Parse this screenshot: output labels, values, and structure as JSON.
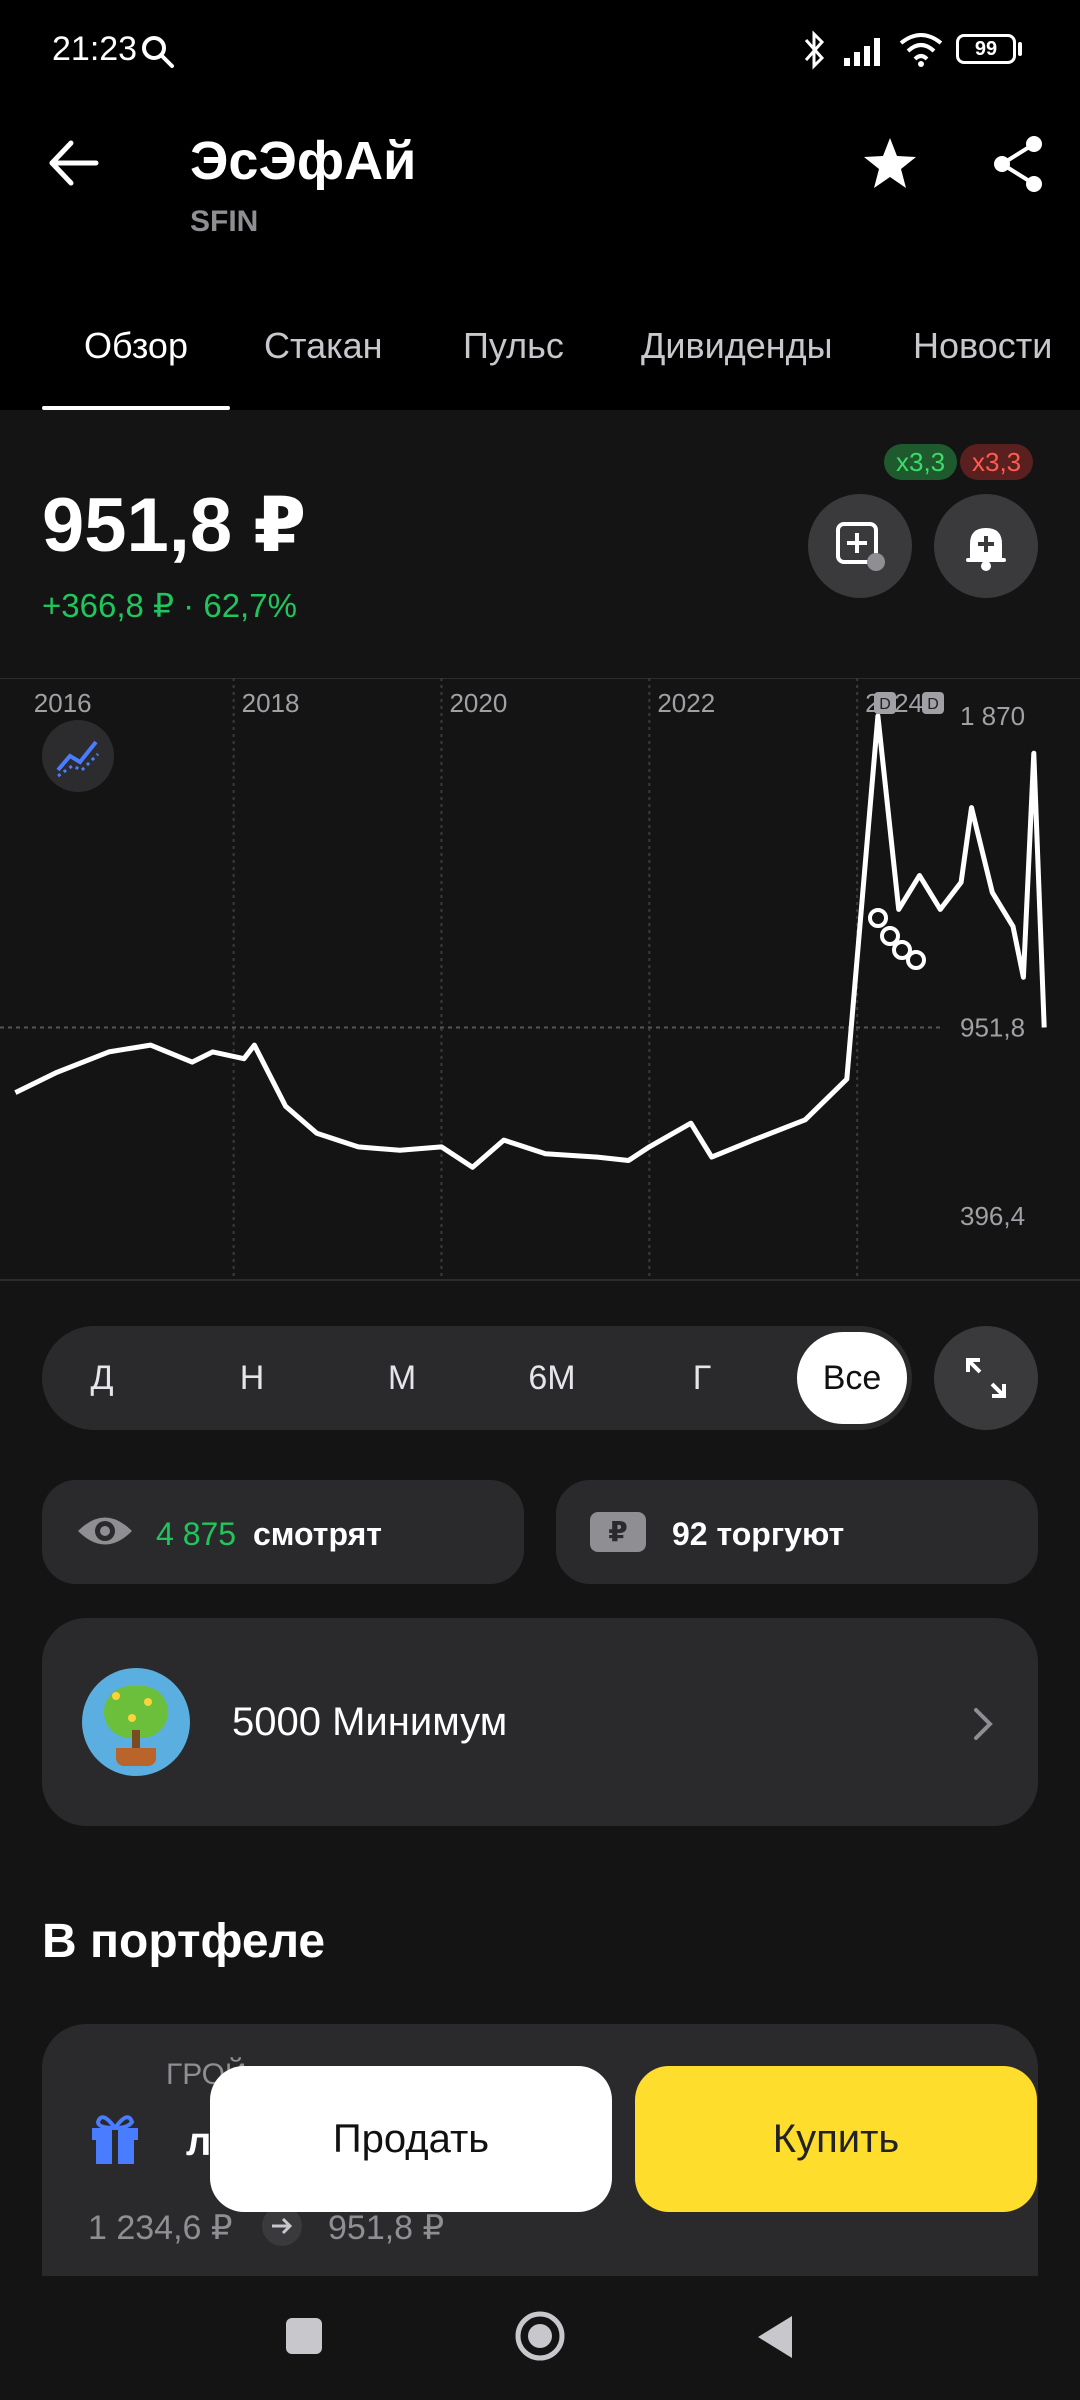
{
  "status_bar": {
    "time": "21:23",
    "battery": "99"
  },
  "header": {
    "title": "ЭсЭфАй",
    "ticker": "SFIN"
  },
  "tabs": [
    {
      "label": "Обзор",
      "active": true
    },
    {
      "label": "Стакан"
    },
    {
      "label": "Пульс"
    },
    {
      "label": "Дивиденды"
    },
    {
      "label": "Новости"
    }
  ],
  "quote": {
    "price": "951,8 ₽",
    "change": "+366,8 ₽ · 62,7%",
    "badge_green": "x3,3",
    "badge_red": "x3,3"
  },
  "chart_data": {
    "type": "line",
    "x_tick_labels": [
      "2016",
      "2018",
      "2020",
      "2022",
      "2024"
    ],
    "y_tick_labels": [
      "1 870",
      "951,8",
      "396,4"
    ],
    "current_value": 951.8,
    "ylim_labels": [
      396.4,
      1870
    ],
    "dividend_markers": [
      "D",
      "D"
    ],
    "series": [
      {
        "values": [
          {
            "x": 2015.9,
            "y": 760
          },
          {
            "x": 2016.3,
            "y": 820
          },
          {
            "x": 2016.8,
            "y": 880
          },
          {
            "x": 2017.2,
            "y": 900
          },
          {
            "x": 2017.6,
            "y": 850
          },
          {
            "x": 2017.8,
            "y": 880
          },
          {
            "x": 2018.1,
            "y": 860
          },
          {
            "x": 2018.2,
            "y": 900
          },
          {
            "x": 2018.5,
            "y": 720
          },
          {
            "x": 2018.8,
            "y": 640
          },
          {
            "x": 2019.2,
            "y": 600
          },
          {
            "x": 2019.6,
            "y": 590
          },
          {
            "x": 2020.0,
            "y": 600
          },
          {
            "x": 2020.3,
            "y": 540
          },
          {
            "x": 2020.6,
            "y": 620
          },
          {
            "x": 2021.0,
            "y": 580
          },
          {
            "x": 2021.5,
            "y": 570
          },
          {
            "x": 2021.8,
            "y": 560
          },
          {
            "x": 2022.0,
            "y": 600
          },
          {
            "x": 2022.4,
            "y": 670
          },
          {
            "x": 2022.6,
            "y": 570
          },
          {
            "x": 2023.0,
            "y": 620
          },
          {
            "x": 2023.5,
            "y": 680
          },
          {
            "x": 2023.9,
            "y": 800
          },
          {
            "x": 2024.2,
            "y": 1870
          },
          {
            "x": 2024.4,
            "y": 1300
          },
          {
            "x": 2024.6,
            "y": 1400
          },
          {
            "x": 2024.8,
            "y": 1300
          },
          {
            "x": 2025.0,
            "y": 1380
          },
          {
            "x": 2025.1,
            "y": 1600
          },
          {
            "x": 2025.3,
            "y": 1350
          },
          {
            "x": 2025.5,
            "y": 1250
          },
          {
            "x": 2025.6,
            "y": 1100
          },
          {
            "x": 2025.7,
            "y": 1760
          },
          {
            "x": 2025.8,
            "y": 951.8
          }
        ]
      }
    ]
  },
  "periods": [
    "Д",
    "Н",
    "М",
    "6М",
    "Г",
    "Все"
  ],
  "active_period": "Все",
  "stats": {
    "watching_count": "4 875",
    "watching_label": "смотрят",
    "trading_label": "92 торгуют"
  },
  "promo": {
    "label": "5000 Минимум"
  },
  "portfolio": {
    "heading": "В портфеле",
    "obscured_line1": "ГРОЙ",
    "obscured_line2": "л",
    "from_price": "1 234,6 ₽",
    "to_price": "951,8 ₽"
  },
  "actions": {
    "sell": "Продать",
    "buy": "Купить"
  },
  "colors": {
    "positive": "#21c55d",
    "negative": "#ff453a",
    "buy": "#ffdd2d",
    "chart_accent": "#4a7cff"
  }
}
